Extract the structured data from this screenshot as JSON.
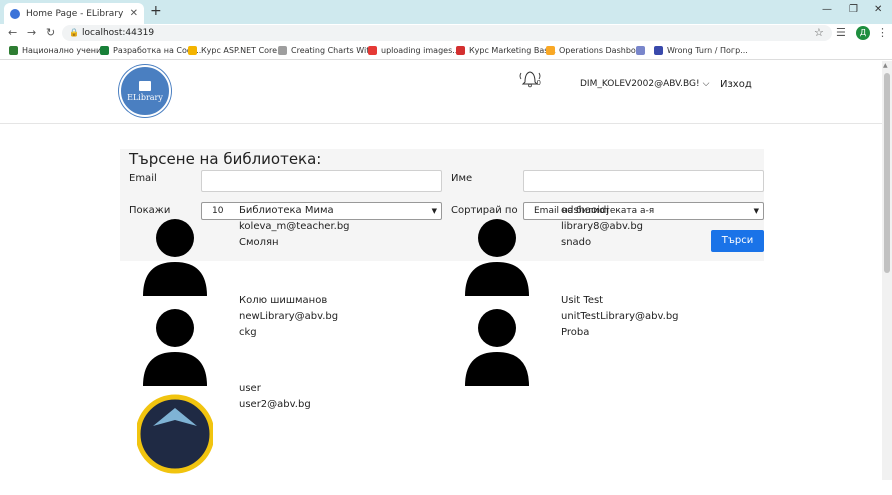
{
  "browser": {
    "tab_title": "Home Page - ELibrary",
    "url": "localhost:44319",
    "profile_initial": "Д",
    "bookmarks": [
      {
        "label": "Национално учени...",
        "color": "#2e7d32"
      },
      {
        "label": "Разработка на Соф...",
        "color": "#188038"
      },
      {
        "label": "Курс ASP.NET Core...",
        "color": "#f4b400"
      },
      {
        "label": "Creating Charts Wit...",
        "color": "#9e9e9e"
      },
      {
        "label": "uploading images...",
        "color": "#e53935"
      },
      {
        "label": "Курс Marketing Bas...",
        "color": "#d32f2f"
      },
      {
        "label": "Operations Dashbo...",
        "color": "#f9a825"
      },
      {
        "label": "",
        "color": "#7986cb"
      },
      {
        "label": "Wrong Turn / Погр...",
        "color": "#3949ab"
      }
    ]
  },
  "header": {
    "logo_text": "ELibrary",
    "notification_count": "0",
    "user_email": "DIM_KOLEV2002@ABV.BG!",
    "logout_label": "Изход"
  },
  "search": {
    "title": "Търсене на библиотека:",
    "email_label": "Email",
    "email_value": "",
    "name_label": "Име",
    "name_value": "",
    "show_label": "Покажи",
    "show_value": "10",
    "sort_label": "Сортирай по",
    "sort_value": "Email на билиотеката а-я",
    "submit_label": "Търси"
  },
  "libraries": [
    {
      "name": "Библиотека Мима",
      "email": "koleva_m@teacher.bg",
      "city": "Смолян"
    },
    {
      "name": "odshaoidj",
      "email": "library8@abv.bg",
      "city": "snado"
    },
    {
      "name": "Колю шишманов",
      "email": "newLibrary@abv.bg",
      "city": "ckg"
    },
    {
      "name": "Usit Test",
      "email": "unitTestLibrary@abv.bg",
      "city": "Proba"
    },
    {
      "name": "user",
      "email": "user2@abv.bg",
      "city": ""
    }
  ]
}
